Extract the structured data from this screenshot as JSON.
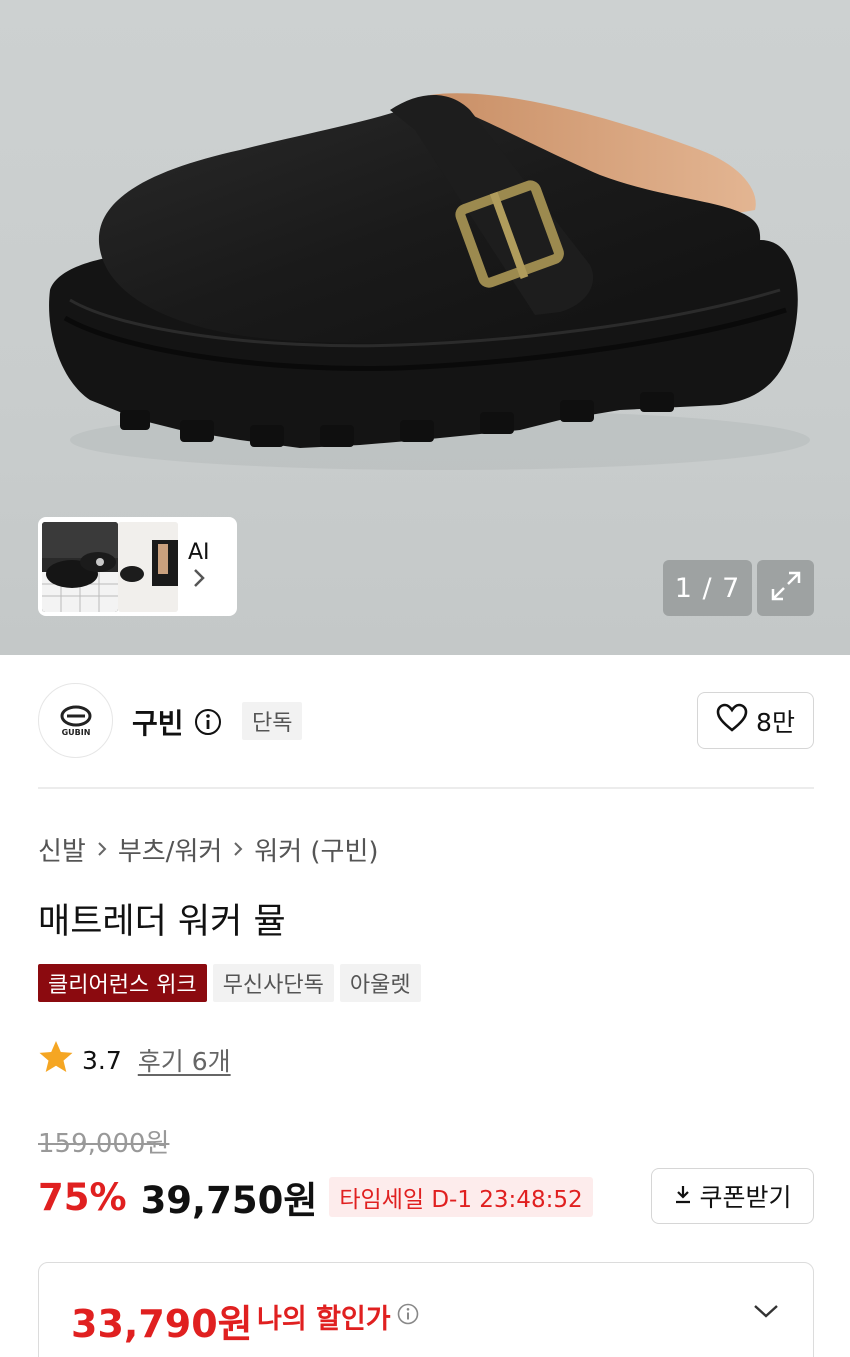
{
  "gallery": {
    "counter": "1 / 7",
    "ai_label": "AI"
  },
  "brand": {
    "name": "구빈",
    "exclusive_badge": "단독",
    "likes": "8만"
  },
  "breadcrumb": [
    "신발",
    "부츠/워커",
    "워커 (구빈)"
  ],
  "product": {
    "title": "매트레더 워커 뮬",
    "tags": [
      "클리어런스 위크",
      "무신사단독",
      "아울렛"
    ],
    "rating": "3.7",
    "reviews": "후기 6개"
  },
  "price": {
    "original": "159,000원",
    "discount": "75%",
    "sale": "39,750원",
    "timesale": "타임세일 D-1 23:48:52",
    "coupon_label": "쿠폰받기"
  },
  "my_discount": {
    "price": "33,790원",
    "label": "나의 할인가"
  },
  "colors": {
    "accent_red": "#e02020",
    "tag_red": "#8b0a0f",
    "star": "#f5a623"
  },
  "icons": [
    "info-icon",
    "heart-icon",
    "download-icon",
    "expand-icon",
    "chevron-right-icon",
    "chevron-down-icon",
    "star-icon"
  ]
}
